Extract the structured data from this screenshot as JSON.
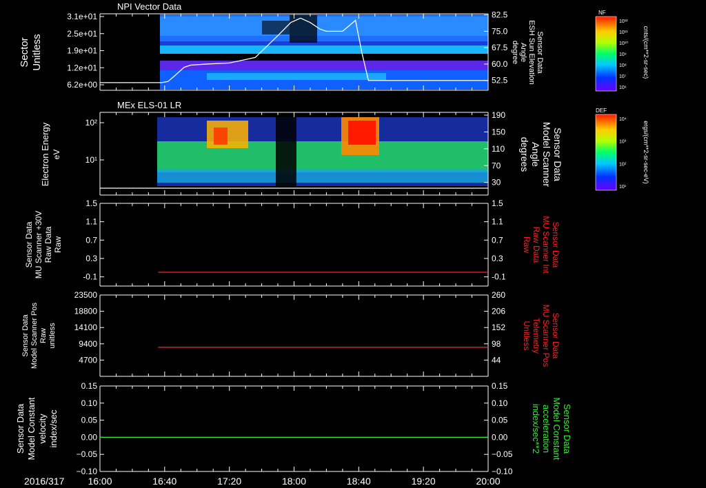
{
  "colors": {
    "background": "#000000",
    "axis": "#ffffff",
    "red_trace": "#ff2020",
    "green_trace": "#33ee33"
  },
  "time_axis": {
    "date_label": "2016/317",
    "tick_labels": [
      "16:00",
      "16:40",
      "17:20",
      "18:00",
      "18:40",
      "19:20",
      "20:00"
    ],
    "range_minutes": [
      0,
      240
    ]
  },
  "colorbars": [
    {
      "tag": "NF",
      "unit_label": "cnts/(cm**2-sr-sec)",
      "tick_labels": [
        "10¹²",
        "10¹¹",
        "10¹⁰",
        "10⁹",
        "10⁸",
        "10⁷",
        "10⁶"
      ]
    },
    {
      "tag": "DEF",
      "unit_label": "ergs/(cm**2-sr-sec-eV)",
      "tick_labels": [
        "10⁴",
        "10³",
        "10²",
        "10¹"
      ]
    }
  ],
  "chart_data": [
    {
      "type": "heatmap",
      "title": "NPI Vector Data",
      "ylabel": [
        "Sector",
        "Unitless"
      ],
      "y_tick_labels": [
        "3.1e+01",
        "2.5e+01",
        "1.9e+01",
        "1.2e+01",
        "6.2e+00"
      ],
      "y2label": [
        "Sensor Data",
        "ESH Sun Elevation",
        "Angle",
        "degree"
      ],
      "y2_ticks": [
        82.5,
        75.0,
        67.5,
        60.0,
        52.5
      ],
      "y2_tick_labels": [
        "82.5",
        "75.0",
        "67.5",
        "60.0",
        "52.5"
      ],
      "y2lim": [
        48,
        83
      ],
      "data_start_minute": 43,
      "overlay_line": {
        "x": [
          0,
          20,
          38,
          42,
          46,
          52,
          56,
          66,
          80,
          96,
          110,
          118,
          124,
          130,
          136,
          140,
          142,
          146,
          150,
          154,
          158,
          162,
          166,
          240
        ],
        "y": [
          51.5,
          51.5,
          51.5,
          52,
          54.5,
          58.5,
          59.5,
          60,
          60.5,
          63,
          73,
          79,
          81,
          79,
          76,
          75,
          75,
          75,
          75,
          77.5,
          80,
          65,
          52.5,
          52.5
        ]
      }
    },
    {
      "type": "heatmap",
      "title": "MEx ELS-01 LR",
      "ylabel": [
        "Electron Energy",
        "eV"
      ],
      "y_tick_labels": [
        "10²",
        "10¹"
      ],
      "y2label": [
        "Sensor Data",
        "Model Scanner",
        "Angle",
        "degrees"
      ],
      "y2_ticks": [
        190,
        150,
        110,
        70,
        30
      ],
      "y2_tick_labels": [
        "190",
        "150",
        "110",
        "70",
        "30"
      ],
      "y2lim": [
        0,
        190
      ],
      "data_start_minute": 41,
      "overlay_line": {
        "x": [
          0,
          240
        ],
        "y": [
          1,
          1
        ]
      }
    },
    {
      "type": "line",
      "ylabel": [
        "Sensor Data",
        "MU Scanner +30V",
        "Raw Data",
        "Raw"
      ],
      "y2label": [
        "Sensor Data",
        "MU Scanner Int",
        "Raw Data",
        "Raw"
      ],
      "y_ticks": [
        1.5,
        1.1,
        0.7,
        0.3,
        -0.1
      ],
      "y_tick_labels": [
        "1.5",
        "1.1",
        "0.7",
        "0.3",
        "-0.1"
      ],
      "ylim": [
        -0.3,
        1.5
      ],
      "series": [
        {
          "x": [
            36,
            240
          ],
          "y": [
            0,
            0
          ]
        }
      ]
    },
    {
      "type": "line",
      "ylabel": [
        "Sensor Data",
        "Model Scanner Pos",
        "Raw",
        "unitless"
      ],
      "y2label": [
        "Sensor Data",
        "MU Scanner Pos",
        "Telemetry",
        "Unitless"
      ],
      "y_ticks": [
        23500,
        18800,
        14100,
        9400,
        4700
      ],
      "y_tick_labels": [
        "23500",
        "18800",
        "14100",
        "9400",
        "4700"
      ],
      "ylim": [
        0,
        23500
      ],
      "y2_ticks": [
        260,
        206,
        152,
        98,
        44
      ],
      "y2_tick_labels": [
        "260",
        "206",
        "152",
        "98",
        "44"
      ],
      "series": [
        {
          "x": [
            36,
            240
          ],
          "y": [
            8400,
            8400
          ]
        }
      ]
    },
    {
      "type": "line",
      "ylabel": [
        "Sensor Data",
        "Model Constant",
        "velocity",
        "index/sec"
      ],
      "y2label": [
        "Sensor Data",
        "Model Constant",
        "acceleration",
        "index/sec**2"
      ],
      "y_ticks": [
        0.15,
        0.1,
        0.05,
        0.0,
        -0.05,
        -0.1
      ],
      "y_tick_labels": [
        "0.15",
        "0.10",
        "0.05",
        "0.00",
        "−0.05",
        "−0.10"
      ],
      "ylim": [
        -0.1,
        0.15
      ],
      "series": [
        {
          "x": [
            0,
            240
          ],
          "y": [
            0,
            0
          ]
        }
      ]
    }
  ]
}
